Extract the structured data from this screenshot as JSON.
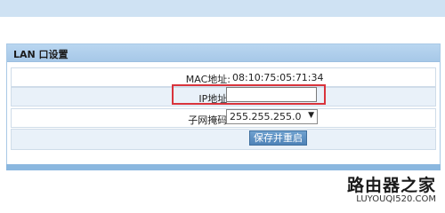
{
  "panel": {
    "title": "LAN 口设置"
  },
  "form": {
    "mac_label": "MAC地址:",
    "mac_value": "08:10:75:05:71:34",
    "ip_label": "IP地址:",
    "ip_value": "",
    "subnet_label": "子网掩码:",
    "subnet_value": "255.255.255.0",
    "save_button": "保存并重启"
  },
  "watermark": {
    "logo_text": "路由器之家",
    "url": "LUYOUQI520.COM"
  },
  "colors": {
    "highlight": "#d9343c",
    "header": "#a7c8e8",
    "button": "#4f83b8"
  }
}
